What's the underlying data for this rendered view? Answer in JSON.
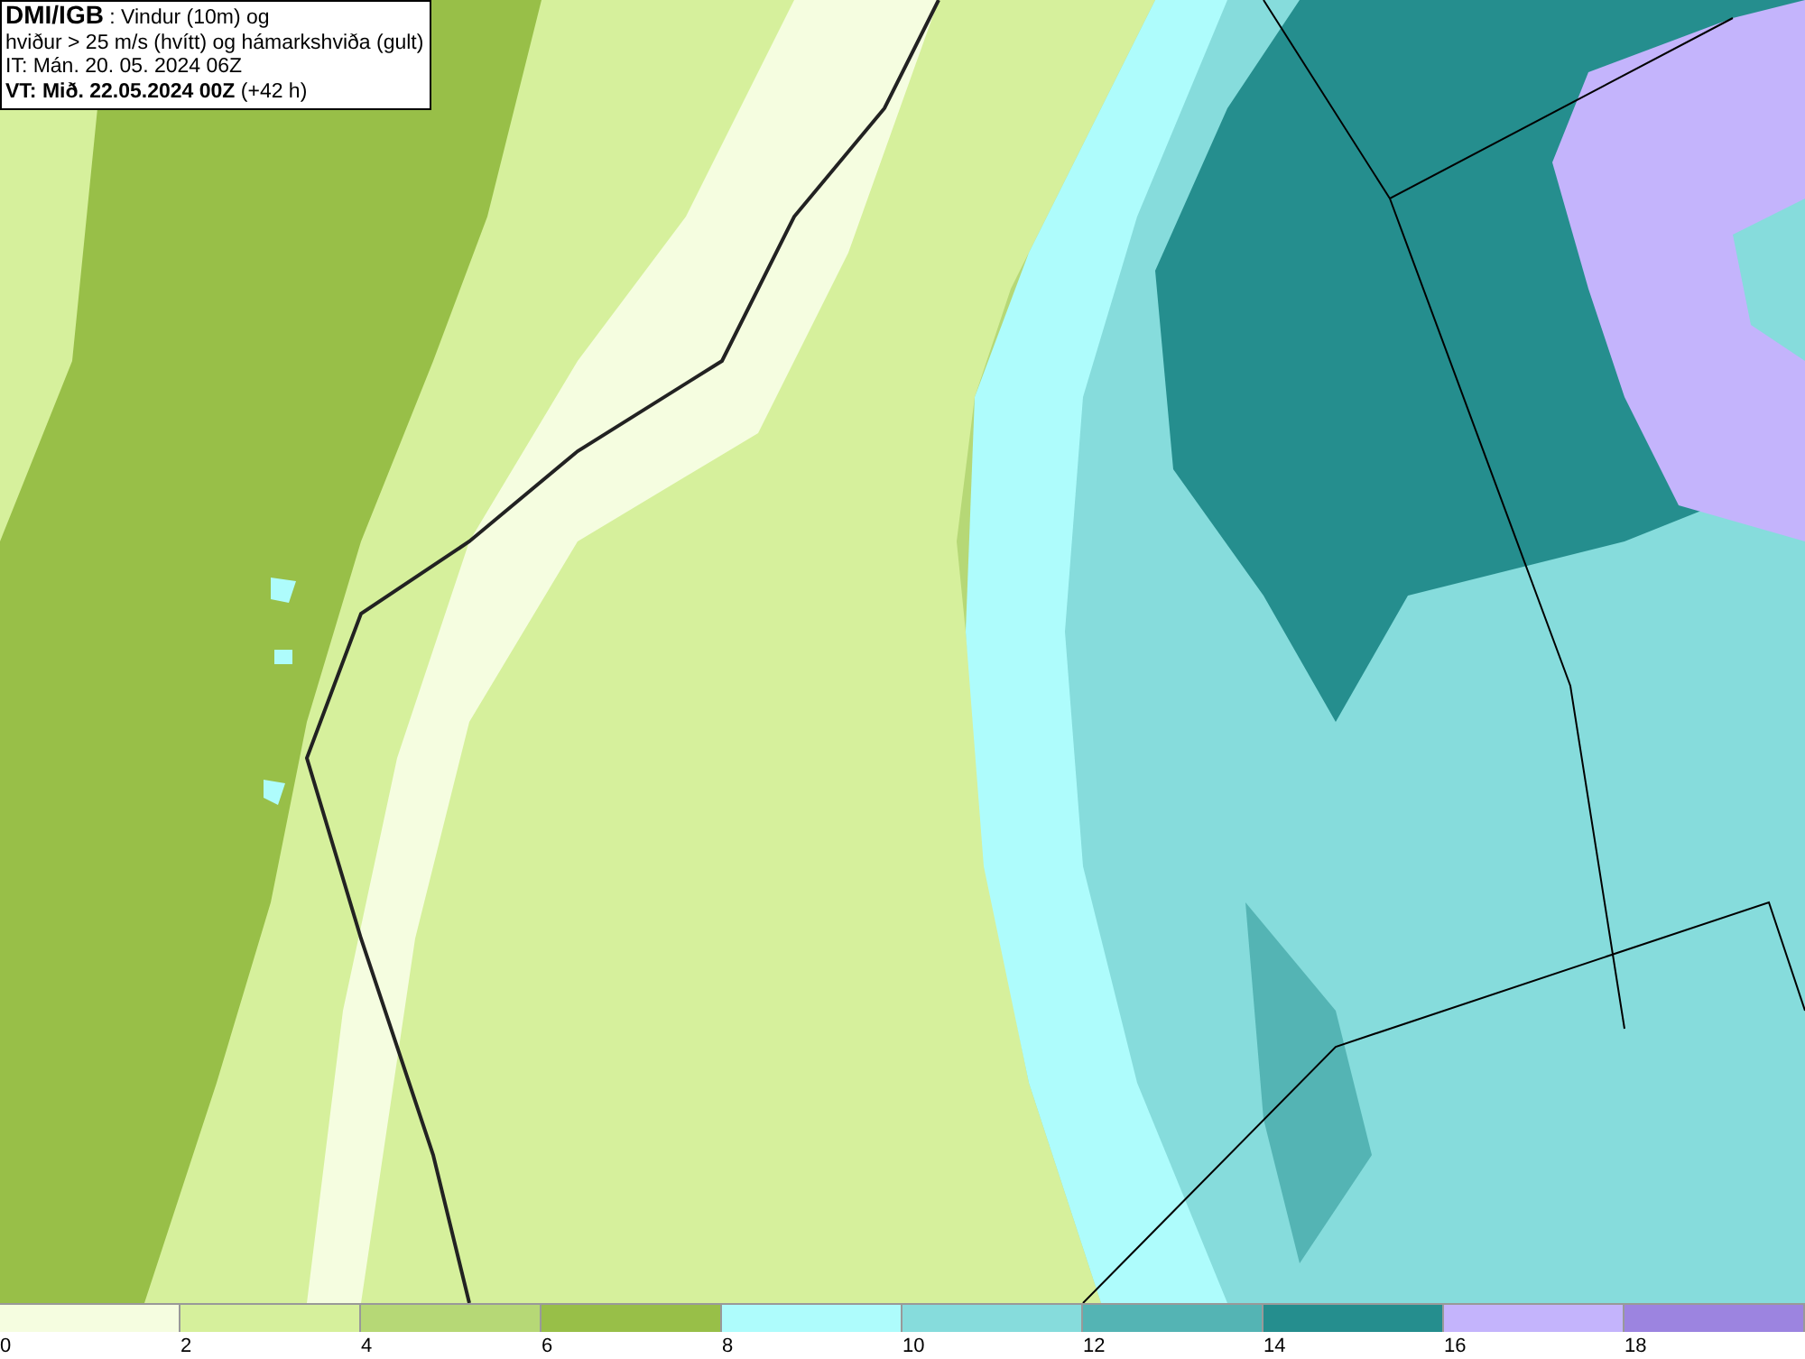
{
  "info_box": {
    "lines": [
      "**DMI/IGB** : Vindur (10m) og",
      "hviður > 25 m/s (hvítt) og hámarkshviða (gult)",
      "IT: Mán. 20. 05. 2024 06Z",
      "**VT: Mið. 22.05.2024 00Z** (+42 h)"
    ]
  },
  "legend": [
    {
      "label": "0",
      "color": "#f5fde0"
    },
    {
      "label": "2",
      "color": "#d6f09c"
    },
    {
      "label": "4",
      "color": "#b6d876"
    },
    {
      "label": "6",
      "color": "#98bf48"
    },
    {
      "label": "8",
      "color": "#aefcfc"
    },
    {
      "label": "10",
      "color": "#86dcdc"
    },
    {
      "label": "12",
      "color": "#54b4b4"
    },
    {
      "label": "14",
      "color": "#258e8e"
    },
    {
      "label": "16",
      "color": "#c4b4fc"
    },
    {
      "label": "18",
      "color": "#9c84e0"
    }
  ]
}
